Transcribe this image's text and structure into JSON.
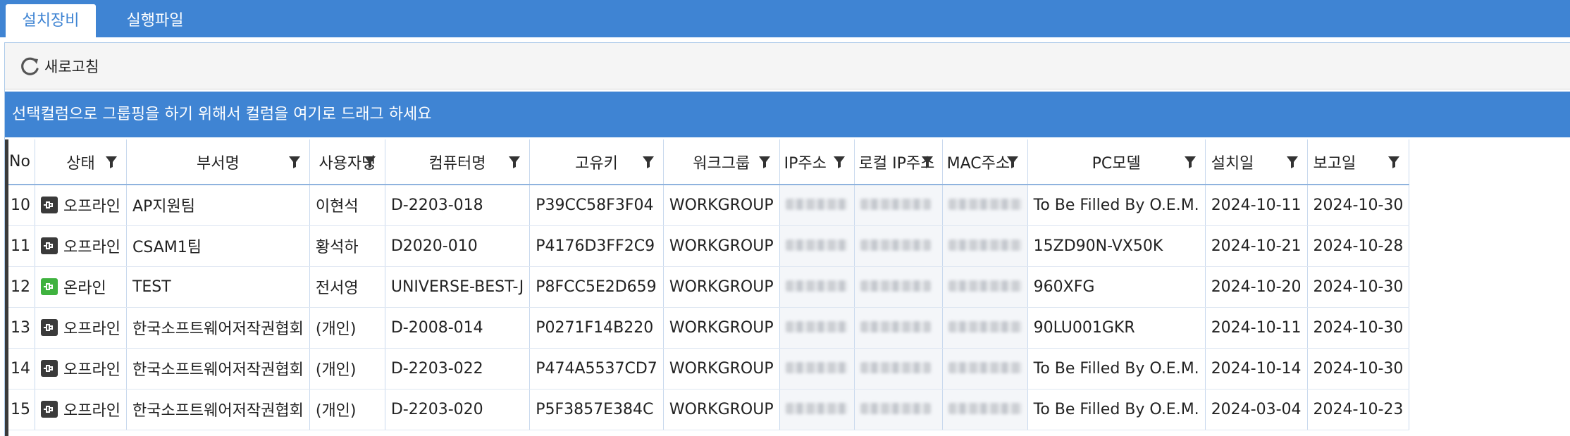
{
  "tabs": [
    {
      "label": "설치장비",
      "active": true
    },
    {
      "label": "실행파일",
      "active": false
    }
  ],
  "toolbar": {
    "refresh_label": "새로고침"
  },
  "group_panel": {
    "text": "선택컬럼으로 그룹핑을 하기 위해서 컬럼을 여기로 드래그 하세요"
  },
  "colors": {
    "accent": "#3f84d3",
    "online": "#3fb23f",
    "offline": "#3a3a3a"
  },
  "columns": [
    "No",
    "상태",
    "부서명",
    "사용자명",
    "컴퓨터명",
    "고유키",
    "워크그룹",
    "IP주소",
    "로컬 IP주소",
    "MAC주소",
    "PC모델",
    "설치일",
    "보고일"
  ],
  "rows": [
    {
      "no": "10",
      "status": "오프라인",
      "online": false,
      "dept": "AP지원팀",
      "user": "이현석",
      "computer": "D-2203-018",
      "key": "P39CC58F3F04",
      "workgroup": "WORKGROUP",
      "ip": "",
      "local_ip": "",
      "mac": "",
      "model": "To Be Filled By O.E.M.",
      "install": "2024-10-11",
      "report": "2024-10-30"
    },
    {
      "no": "11",
      "status": "오프라인",
      "online": false,
      "dept": "CSAM1팀",
      "user": "황석하",
      "computer": "D2020-010",
      "key": "P4176D3FF2C9",
      "workgroup": "WORKGROUP",
      "ip": "",
      "local_ip": "",
      "mac": "",
      "model": "15ZD90N-VX50K",
      "install": "2024-10-21",
      "report": "2024-10-28"
    },
    {
      "no": "12",
      "status": "온라인",
      "online": true,
      "dept": "TEST",
      "user": "전서영",
      "computer": "UNIVERSE-BEST-J",
      "key": "P8FCC5E2D659",
      "workgroup": "WORKGROUP",
      "ip": "",
      "local_ip": "",
      "mac": "",
      "model": "960XFG",
      "install": "2024-10-20",
      "report": "2024-10-30"
    },
    {
      "no": "13",
      "status": "오프라인",
      "online": false,
      "dept": "한국소프트웨어저작권협회",
      "user": "(개인)",
      "computer": "D-2008-014",
      "key": "P0271F14B220",
      "workgroup": "WORKGROUP",
      "ip": "",
      "local_ip": "",
      "mac": "",
      "model": "90LU001GKR",
      "install": "2024-10-11",
      "report": "2024-10-30"
    },
    {
      "no": "14",
      "status": "오프라인",
      "online": false,
      "dept": "한국소프트웨어저작권협회",
      "user": "(개인)",
      "computer": "D-2203-022",
      "key": "P474A5537CD7",
      "workgroup": "WORKGROUP",
      "ip": "",
      "local_ip": "",
      "mac": "",
      "model": "To Be Filled By O.E.M.",
      "install": "2024-10-14",
      "report": "2024-10-30"
    },
    {
      "no": "15",
      "status": "오프라인",
      "online": false,
      "dept": "한국소프트웨어저작권협회",
      "user": "(개인)",
      "computer": "D-2203-020",
      "key": "P5F3857E384C",
      "workgroup": "WORKGROUP",
      "ip": "",
      "local_ip": "",
      "mac": "",
      "model": "To Be Filled By O.E.M.",
      "install": "2024-03-04",
      "report": "2024-10-23"
    }
  ]
}
